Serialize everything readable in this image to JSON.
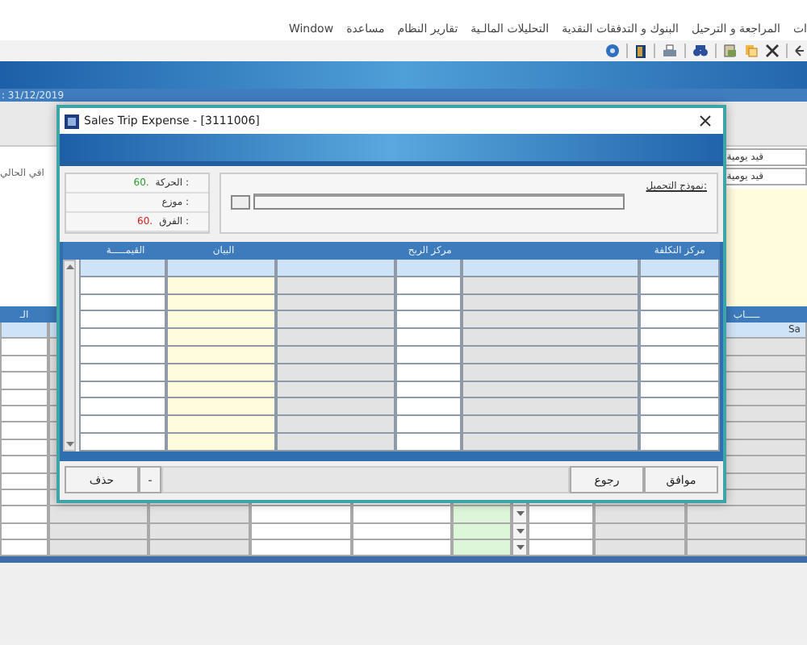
{
  "menu": [
    "ات",
    "المراجعة و الترحيل",
    "البنوك و التدفقات النقدية",
    "التحليلات المالـية",
    "تقارير النظام",
    "مساعدة",
    "Window"
  ],
  "header_date": ": 31/12/2019",
  "side_labels": [
    "قيد يومية",
    "قيد يومية"
  ],
  "left_label": "اقي الحالي",
  "grid": {
    "columns": [
      {
        "kind": "readonly",
        "label": "ـــــاب"
      },
      {
        "kind": "readonly"
      },
      {
        "kind": "input"
      },
      {
        "kind": "dropdown"
      },
      {
        "kind": "highlight"
      },
      {
        "kind": "input"
      },
      {
        "kind": "input"
      },
      {
        "kind": "readonly"
      },
      {
        "kind": "readonly"
      },
      {
        "kind": "input",
        "label": "الـ"
      }
    ],
    "rows": [
      {
        "selected": true,
        "column_1": "Sa"
      },
      {
        "selected": false
      },
      {
        "selected": false
      },
      {
        "selected": false
      },
      {
        "selected": false
      },
      {
        "selected": false
      },
      {
        "selected": false
      },
      {
        "selected": false
      },
      {
        "selected": false
      },
      {
        "selected": false
      },
      {
        "selected": false
      },
      {
        "selected": false
      },
      {
        "selected": false
      },
      {
        "selected": false
      }
    ]
  },
  "dialog": {
    "title": "Sales Trip Expense - [3111006]",
    "totals": [
      {
        "label": "الحركة :",
        "value": "60.",
        "color": "#2e9a2e"
      },
      {
        "label": "موزع :"
      },
      {
        "label": "الفرق :",
        "value": "60.",
        "color": "#d02020"
      }
    ],
    "template_label": "نموذج التحميل:",
    "columns": [
      {
        "kind": "input",
        "label": "مركز التكلفة"
      },
      {
        "kind": "readonly"
      },
      {
        "kind": "input",
        "label": "مركز الربح"
      },
      {
        "kind": "readonly"
      },
      {
        "kind": "text",
        "label": "البيان"
      },
      {
        "kind": "input",
        "label": "القيمـــــة"
      }
    ],
    "rows": [
      {
        "selected": true
      },
      {
        "selected": false
      },
      {
        "selected": false
      },
      {
        "selected": false
      },
      {
        "selected": false
      },
      {
        "selected": false
      },
      {
        "selected": false
      },
      {
        "selected": false
      },
      {
        "selected": false
      },
      {
        "selected": false
      },
      {
        "selected": false
      }
    ],
    "buttons_right": [
      "موافق",
      "رجوع"
    ],
    "buttons_left": [
      "-",
      "حذف"
    ]
  }
}
